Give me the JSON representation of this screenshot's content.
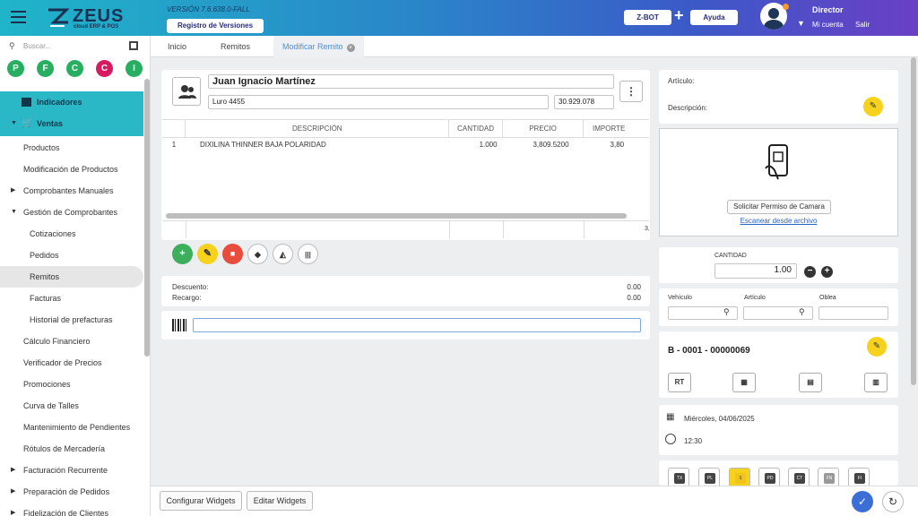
{
  "header": {
    "logo_text": "ZEUS",
    "logo_sub": "cloud ERP & POS",
    "version": "VERSIÓN 7.6.638.0-FALL",
    "registro_label": "Registro de Versiones",
    "zbot_label": "Z-BOT",
    "plus": "+",
    "ayuda_label": "Ayuda",
    "user_role": "Director",
    "mi_cuenta": "Mi cuenta",
    "salir": "Salir"
  },
  "sidebar": {
    "search_placeholder": "Buscar...",
    "shortcuts": [
      {
        "letter": "P",
        "color": "#27ae60"
      },
      {
        "letter": "F",
        "color": "#27ae60"
      },
      {
        "letter": "C",
        "color": "#27ae60"
      },
      {
        "letter": "C",
        "color": "#d81b60"
      },
      {
        "letter": "I",
        "color": "#27ae60"
      }
    ],
    "items": [
      {
        "label": "Indicadores"
      },
      {
        "label": "Ventas"
      },
      {
        "label": "Productos"
      },
      {
        "label": "Modificación de Productos"
      },
      {
        "label": "Comprobantes Manuales"
      },
      {
        "label": "Gestión de Comprobantes"
      },
      {
        "label": "Cotizaciones"
      },
      {
        "label": "Pedidos"
      },
      {
        "label": "Remitos"
      },
      {
        "label": "Facturas"
      },
      {
        "label": "Historial de prefacturas"
      },
      {
        "label": "Cálculo Financiero"
      },
      {
        "label": "Verificador de Precios"
      },
      {
        "label": "Promociones"
      },
      {
        "label": "Curva de Talles"
      },
      {
        "label": "Mantenimiento de Pendientes"
      },
      {
        "label": "Rótulos de Mercadería"
      },
      {
        "label": "Facturación Recurrente"
      },
      {
        "label": "Preparación de Pedidos"
      },
      {
        "label": "Fidelización de Clientes"
      }
    ]
  },
  "tabs": [
    "Inicio",
    "Remitos",
    "Modificar Remito"
  ],
  "tab_close": "×",
  "customer": {
    "name": "Juan Ignacio Martínez",
    "address": "Luro 4455",
    "doc": "30.929.078",
    "kebab": "⋮"
  },
  "grid": {
    "headers": [
      "DESCRIPCIÓN",
      "CANTIDAD",
      "PRECIO",
      "IMPORTE"
    ],
    "rows": [
      {
        "n": "1",
        "desc": "DIXILINA THINNER BAJA POLARIDAD",
        "qty": "1.000",
        "price": "3,809.5200",
        "amount": "3,80"
      }
    ],
    "footer_amount": "3,"
  },
  "actions": {
    "add": "+",
    "edit": "✎",
    "delete": "🗑",
    "tag": "●",
    "barcode": "|||"
  },
  "totals": {
    "descuento_label": "Descuento:",
    "descuento_value": "0.00",
    "recargo_label": "Recargo:",
    "recargo_value": "0.00"
  },
  "right": {
    "articulo_label": "Artículo:",
    "descripcion_label": "Descripción:",
    "camera_btn": "Solicitar Permiso de Camara",
    "scan_link": "Escanear desde archivo",
    "cantidad_label": "CANTIDAD",
    "cantidad_value": "1.00",
    "minus": "−",
    "plus": "+",
    "vehiculo_label": "Vehículo",
    "articulo2_label": "Artículo",
    "oblea_label": "Oblea",
    "comprobante": "B - 0001 - 00000069",
    "rt_label": "RT",
    "date": "Miércoles, 04/06/2025",
    "time": "12:30",
    "mini_labels": [
      "TX",
      "PL",
      "$",
      "PD",
      "CT",
      "FN",
      "FI"
    ]
  },
  "footer": {
    "configurar": "Configurar Widgets",
    "editar": "Editar Widgets",
    "check": "✓",
    "refresh": "↻"
  },
  "colors": {
    "accent": "#2bb8c6",
    "green": "#3cae5c",
    "yellow": "#f7d21c",
    "red": "#e74c3c",
    "blue": "#3b6fd6"
  }
}
